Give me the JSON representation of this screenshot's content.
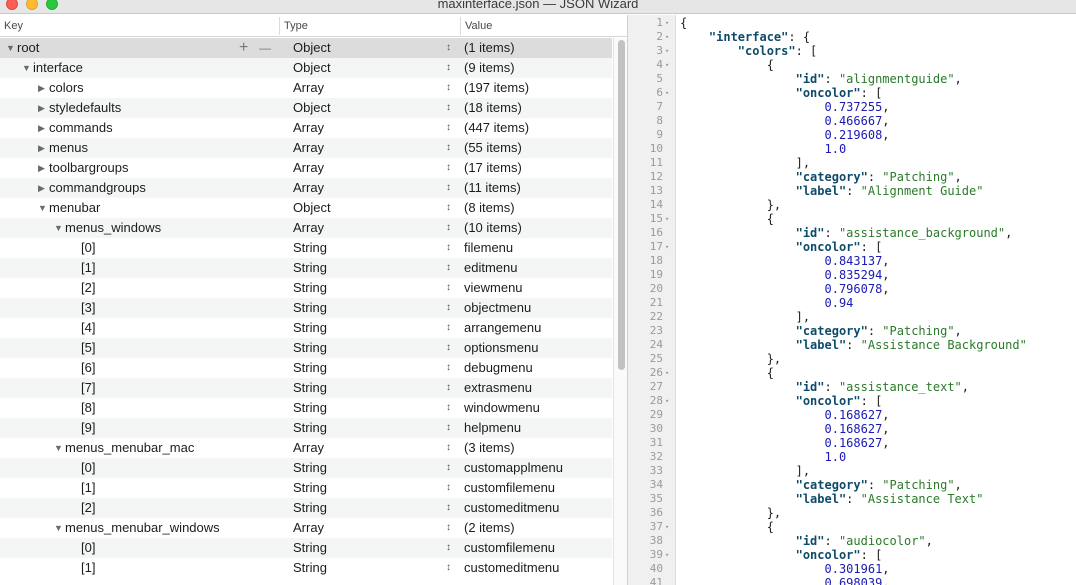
{
  "window": {
    "title": "maxinterface.json — JSON Wizard"
  },
  "tree": {
    "columns": {
      "key": "Key",
      "type": "Type",
      "value": "Value"
    },
    "rows": [
      {
        "key": "root",
        "type": "Object",
        "value": "(1 items)",
        "depth": 0,
        "disclosure": "open",
        "selected": true,
        "add_label": "+",
        "remove_label": "—"
      },
      {
        "key": "interface",
        "type": "Object",
        "value": "(9 items)",
        "depth": 1,
        "disclosure": "open"
      },
      {
        "key": "colors",
        "type": "Array",
        "value": "(197 items)",
        "depth": 2,
        "disclosure": "closed"
      },
      {
        "key": "styledefaults",
        "type": "Object",
        "value": "(18 items)",
        "depth": 2,
        "disclosure": "closed"
      },
      {
        "key": "commands",
        "type": "Array",
        "value": "(447 items)",
        "depth": 2,
        "disclosure": "closed"
      },
      {
        "key": "menus",
        "type": "Array",
        "value": "(55 items)",
        "depth": 2,
        "disclosure": "closed"
      },
      {
        "key": "toolbargroups",
        "type": "Array",
        "value": "(17 items)",
        "depth": 2,
        "disclosure": "closed"
      },
      {
        "key": "commandgroups",
        "type": "Array",
        "value": "(11 items)",
        "depth": 2,
        "disclosure": "closed"
      },
      {
        "key": "menubar",
        "type": "Object",
        "value": "(8 items)",
        "depth": 2,
        "disclosure": "open"
      },
      {
        "key": "menus_windows",
        "type": "Array",
        "value": "(10 items)",
        "depth": 3,
        "disclosure": "open"
      },
      {
        "key": "[0]",
        "type": "String",
        "value": "filemenu",
        "depth": 4,
        "disclosure": "none"
      },
      {
        "key": "[1]",
        "type": "String",
        "value": "editmenu",
        "depth": 4,
        "disclosure": "none"
      },
      {
        "key": "[2]",
        "type": "String",
        "value": "viewmenu",
        "depth": 4,
        "disclosure": "none"
      },
      {
        "key": "[3]",
        "type": "String",
        "value": "objectmenu",
        "depth": 4,
        "disclosure": "none"
      },
      {
        "key": "[4]",
        "type": "String",
        "value": "arrangemenu",
        "depth": 4,
        "disclosure": "none"
      },
      {
        "key": "[5]",
        "type": "String",
        "value": "optionsmenu",
        "depth": 4,
        "disclosure": "none"
      },
      {
        "key": "[6]",
        "type": "String",
        "value": "debugmenu",
        "depth": 4,
        "disclosure": "none"
      },
      {
        "key": "[7]",
        "type": "String",
        "value": "extrasmenu",
        "depth": 4,
        "disclosure": "none"
      },
      {
        "key": "[8]",
        "type": "String",
        "value": "windowmenu",
        "depth": 4,
        "disclosure": "none"
      },
      {
        "key": "[9]",
        "type": "String",
        "value": "helpmenu",
        "depth": 4,
        "disclosure": "none"
      },
      {
        "key": "menus_menubar_mac",
        "type": "Array",
        "value": "(3 items)",
        "depth": 3,
        "disclosure": "open"
      },
      {
        "key": "[0]",
        "type": "String",
        "value": "customapplmenu",
        "depth": 4,
        "disclosure": "none"
      },
      {
        "key": "[1]",
        "type": "String",
        "value": "customfilemenu",
        "depth": 4,
        "disclosure": "none"
      },
      {
        "key": "[2]",
        "type": "String",
        "value": "customeditmenu",
        "depth": 4,
        "disclosure": "none"
      },
      {
        "key": "menus_menubar_windows",
        "type": "Array",
        "value": "(2 items)",
        "depth": 3,
        "disclosure": "open"
      },
      {
        "key": "[0]",
        "type": "String",
        "value": "customfilemenu",
        "depth": 4,
        "disclosure": "none"
      },
      {
        "key": "[1]",
        "type": "String",
        "value": "customeditmenu",
        "depth": 4,
        "disclosure": "none"
      }
    ]
  },
  "code": {
    "lines": [
      {
        "n": "1",
        "fold": "▾",
        "t": [
          [
            "p",
            "{"
          ]
        ]
      },
      {
        "n": "2",
        "fold": "▾",
        "t": [
          [
            "p",
            "    "
          ],
          [
            "k",
            "\"interface\""
          ],
          [
            "p",
            ": {"
          ]
        ]
      },
      {
        "n": "3",
        "fold": "▾",
        "t": [
          [
            "p",
            "        "
          ],
          [
            "k",
            "\"colors\""
          ],
          [
            "p",
            ": ["
          ]
        ]
      },
      {
        "n": "4",
        "fold": "▾",
        "t": [
          [
            "p",
            "            {"
          ]
        ]
      },
      {
        "n": "5",
        "fold": "",
        "t": [
          [
            "p",
            "                "
          ],
          [
            "k",
            "\"id\""
          ],
          [
            "p",
            ": "
          ],
          [
            "s",
            "\"alignmentguide\""
          ],
          [
            "p",
            ","
          ]
        ]
      },
      {
        "n": "6",
        "fold": "▾",
        "t": [
          [
            "p",
            "                "
          ],
          [
            "k",
            "\"oncolor\""
          ],
          [
            "p",
            ": ["
          ]
        ]
      },
      {
        "n": "7",
        "fold": "",
        "t": [
          [
            "p",
            "                    "
          ],
          [
            "n",
            "0.737255"
          ],
          [
            "p",
            ","
          ]
        ]
      },
      {
        "n": "8",
        "fold": "",
        "t": [
          [
            "p",
            "                    "
          ],
          [
            "n",
            "0.466667"
          ],
          [
            "p",
            ","
          ]
        ]
      },
      {
        "n": "9",
        "fold": "",
        "t": [
          [
            "p",
            "                    "
          ],
          [
            "n",
            "0.219608"
          ],
          [
            "p",
            ","
          ]
        ]
      },
      {
        "n": "10",
        "fold": "",
        "t": [
          [
            "p",
            "                    "
          ],
          [
            "n",
            "1.0"
          ]
        ]
      },
      {
        "n": "11",
        "fold": "",
        "t": [
          [
            "p",
            "                ],"
          ]
        ]
      },
      {
        "n": "12",
        "fold": "",
        "t": [
          [
            "p",
            "                "
          ],
          [
            "k",
            "\"category\""
          ],
          [
            "p",
            ": "
          ],
          [
            "s",
            "\"Patching\""
          ],
          [
            "p",
            ","
          ]
        ]
      },
      {
        "n": "13",
        "fold": "",
        "t": [
          [
            "p",
            "                "
          ],
          [
            "k",
            "\"label\""
          ],
          [
            "p",
            ": "
          ],
          [
            "s",
            "\"Alignment Guide\""
          ]
        ]
      },
      {
        "n": "14",
        "fold": "",
        "t": [
          [
            "p",
            "            },"
          ]
        ]
      },
      {
        "n": "15",
        "fold": "▾",
        "t": [
          [
            "p",
            "            {"
          ]
        ]
      },
      {
        "n": "16",
        "fold": "",
        "t": [
          [
            "p",
            "                "
          ],
          [
            "k",
            "\"id\""
          ],
          [
            "p",
            ": "
          ],
          [
            "s",
            "\"assistance_background\""
          ],
          [
            "p",
            ","
          ]
        ]
      },
      {
        "n": "17",
        "fold": "▾",
        "t": [
          [
            "p",
            "                "
          ],
          [
            "k",
            "\"oncolor\""
          ],
          [
            "p",
            ": ["
          ]
        ]
      },
      {
        "n": "18",
        "fold": "",
        "t": [
          [
            "p",
            "                    "
          ],
          [
            "n",
            "0.843137"
          ],
          [
            "p",
            ","
          ]
        ]
      },
      {
        "n": "19",
        "fold": "",
        "t": [
          [
            "p",
            "                    "
          ],
          [
            "n",
            "0.835294"
          ],
          [
            "p",
            ","
          ]
        ]
      },
      {
        "n": "20",
        "fold": "",
        "t": [
          [
            "p",
            "                    "
          ],
          [
            "n",
            "0.796078"
          ],
          [
            "p",
            ","
          ]
        ]
      },
      {
        "n": "21",
        "fold": "",
        "t": [
          [
            "p",
            "                    "
          ],
          [
            "n",
            "0.94"
          ]
        ]
      },
      {
        "n": "22",
        "fold": "",
        "t": [
          [
            "p",
            "                ],"
          ]
        ]
      },
      {
        "n": "23",
        "fold": "",
        "t": [
          [
            "p",
            "                "
          ],
          [
            "k",
            "\"category\""
          ],
          [
            "p",
            ": "
          ],
          [
            "s",
            "\"Patching\""
          ],
          [
            "p",
            ","
          ]
        ]
      },
      {
        "n": "24",
        "fold": "",
        "t": [
          [
            "p",
            "                "
          ],
          [
            "k",
            "\"label\""
          ],
          [
            "p",
            ": "
          ],
          [
            "s",
            "\"Assistance Background\""
          ]
        ]
      },
      {
        "n": "25",
        "fold": "",
        "t": [
          [
            "p",
            "            },"
          ]
        ]
      },
      {
        "n": "26",
        "fold": "▾",
        "t": [
          [
            "p",
            "            {"
          ]
        ]
      },
      {
        "n": "27",
        "fold": "",
        "t": [
          [
            "p",
            "                "
          ],
          [
            "k",
            "\"id\""
          ],
          [
            "p",
            ": "
          ],
          [
            "s",
            "\"assistance_text\""
          ],
          [
            "p",
            ","
          ]
        ]
      },
      {
        "n": "28",
        "fold": "▾",
        "t": [
          [
            "p",
            "                "
          ],
          [
            "k",
            "\"oncolor\""
          ],
          [
            "p",
            ": ["
          ]
        ]
      },
      {
        "n": "29",
        "fold": "",
        "t": [
          [
            "p",
            "                    "
          ],
          [
            "n",
            "0.168627"
          ],
          [
            "p",
            ","
          ]
        ]
      },
      {
        "n": "30",
        "fold": "",
        "t": [
          [
            "p",
            "                    "
          ],
          [
            "n",
            "0.168627"
          ],
          [
            "p",
            ","
          ]
        ]
      },
      {
        "n": "31",
        "fold": "",
        "t": [
          [
            "p",
            "                    "
          ],
          [
            "n",
            "0.168627"
          ],
          [
            "p",
            ","
          ]
        ]
      },
      {
        "n": "32",
        "fold": "",
        "t": [
          [
            "p",
            "                    "
          ],
          [
            "n",
            "1.0"
          ]
        ]
      },
      {
        "n": "33",
        "fold": "",
        "t": [
          [
            "p",
            "                ],"
          ]
        ]
      },
      {
        "n": "34",
        "fold": "",
        "t": [
          [
            "p",
            "                "
          ],
          [
            "k",
            "\"category\""
          ],
          [
            "p",
            ": "
          ],
          [
            "s",
            "\"Patching\""
          ],
          [
            "p",
            ","
          ]
        ]
      },
      {
        "n": "35",
        "fold": "",
        "t": [
          [
            "p",
            "                "
          ],
          [
            "k",
            "\"label\""
          ],
          [
            "p",
            ": "
          ],
          [
            "s",
            "\"Assistance Text\""
          ]
        ]
      },
      {
        "n": "36",
        "fold": "",
        "t": [
          [
            "p",
            "            },"
          ]
        ]
      },
      {
        "n": "37",
        "fold": "▾",
        "t": [
          [
            "p",
            "            {"
          ]
        ]
      },
      {
        "n": "38",
        "fold": "",
        "t": [
          [
            "p",
            "                "
          ],
          [
            "k",
            "\"id\""
          ],
          [
            "p",
            ": "
          ],
          [
            "s",
            "\"audiocolor\""
          ],
          [
            "p",
            ","
          ]
        ]
      },
      {
        "n": "39",
        "fold": "▾",
        "t": [
          [
            "p",
            "                "
          ],
          [
            "k",
            "\"oncolor\""
          ],
          [
            "p",
            ": ["
          ]
        ]
      },
      {
        "n": "40",
        "fold": "",
        "t": [
          [
            "p",
            "                    "
          ],
          [
            "n",
            "0.301961"
          ],
          [
            "p",
            ","
          ]
        ]
      },
      {
        "n": "41",
        "fold": "",
        "t": [
          [
            "p",
            "                    "
          ],
          [
            "n",
            "0.698039"
          ],
          [
            "p",
            ","
          ]
        ]
      }
    ]
  },
  "colors": {
    "key_color": "#0e4b6b",
    "string_color": "#2a7a2a",
    "number_color": "#1a1ab4",
    "selected_row": "#dcdcdc"
  }
}
